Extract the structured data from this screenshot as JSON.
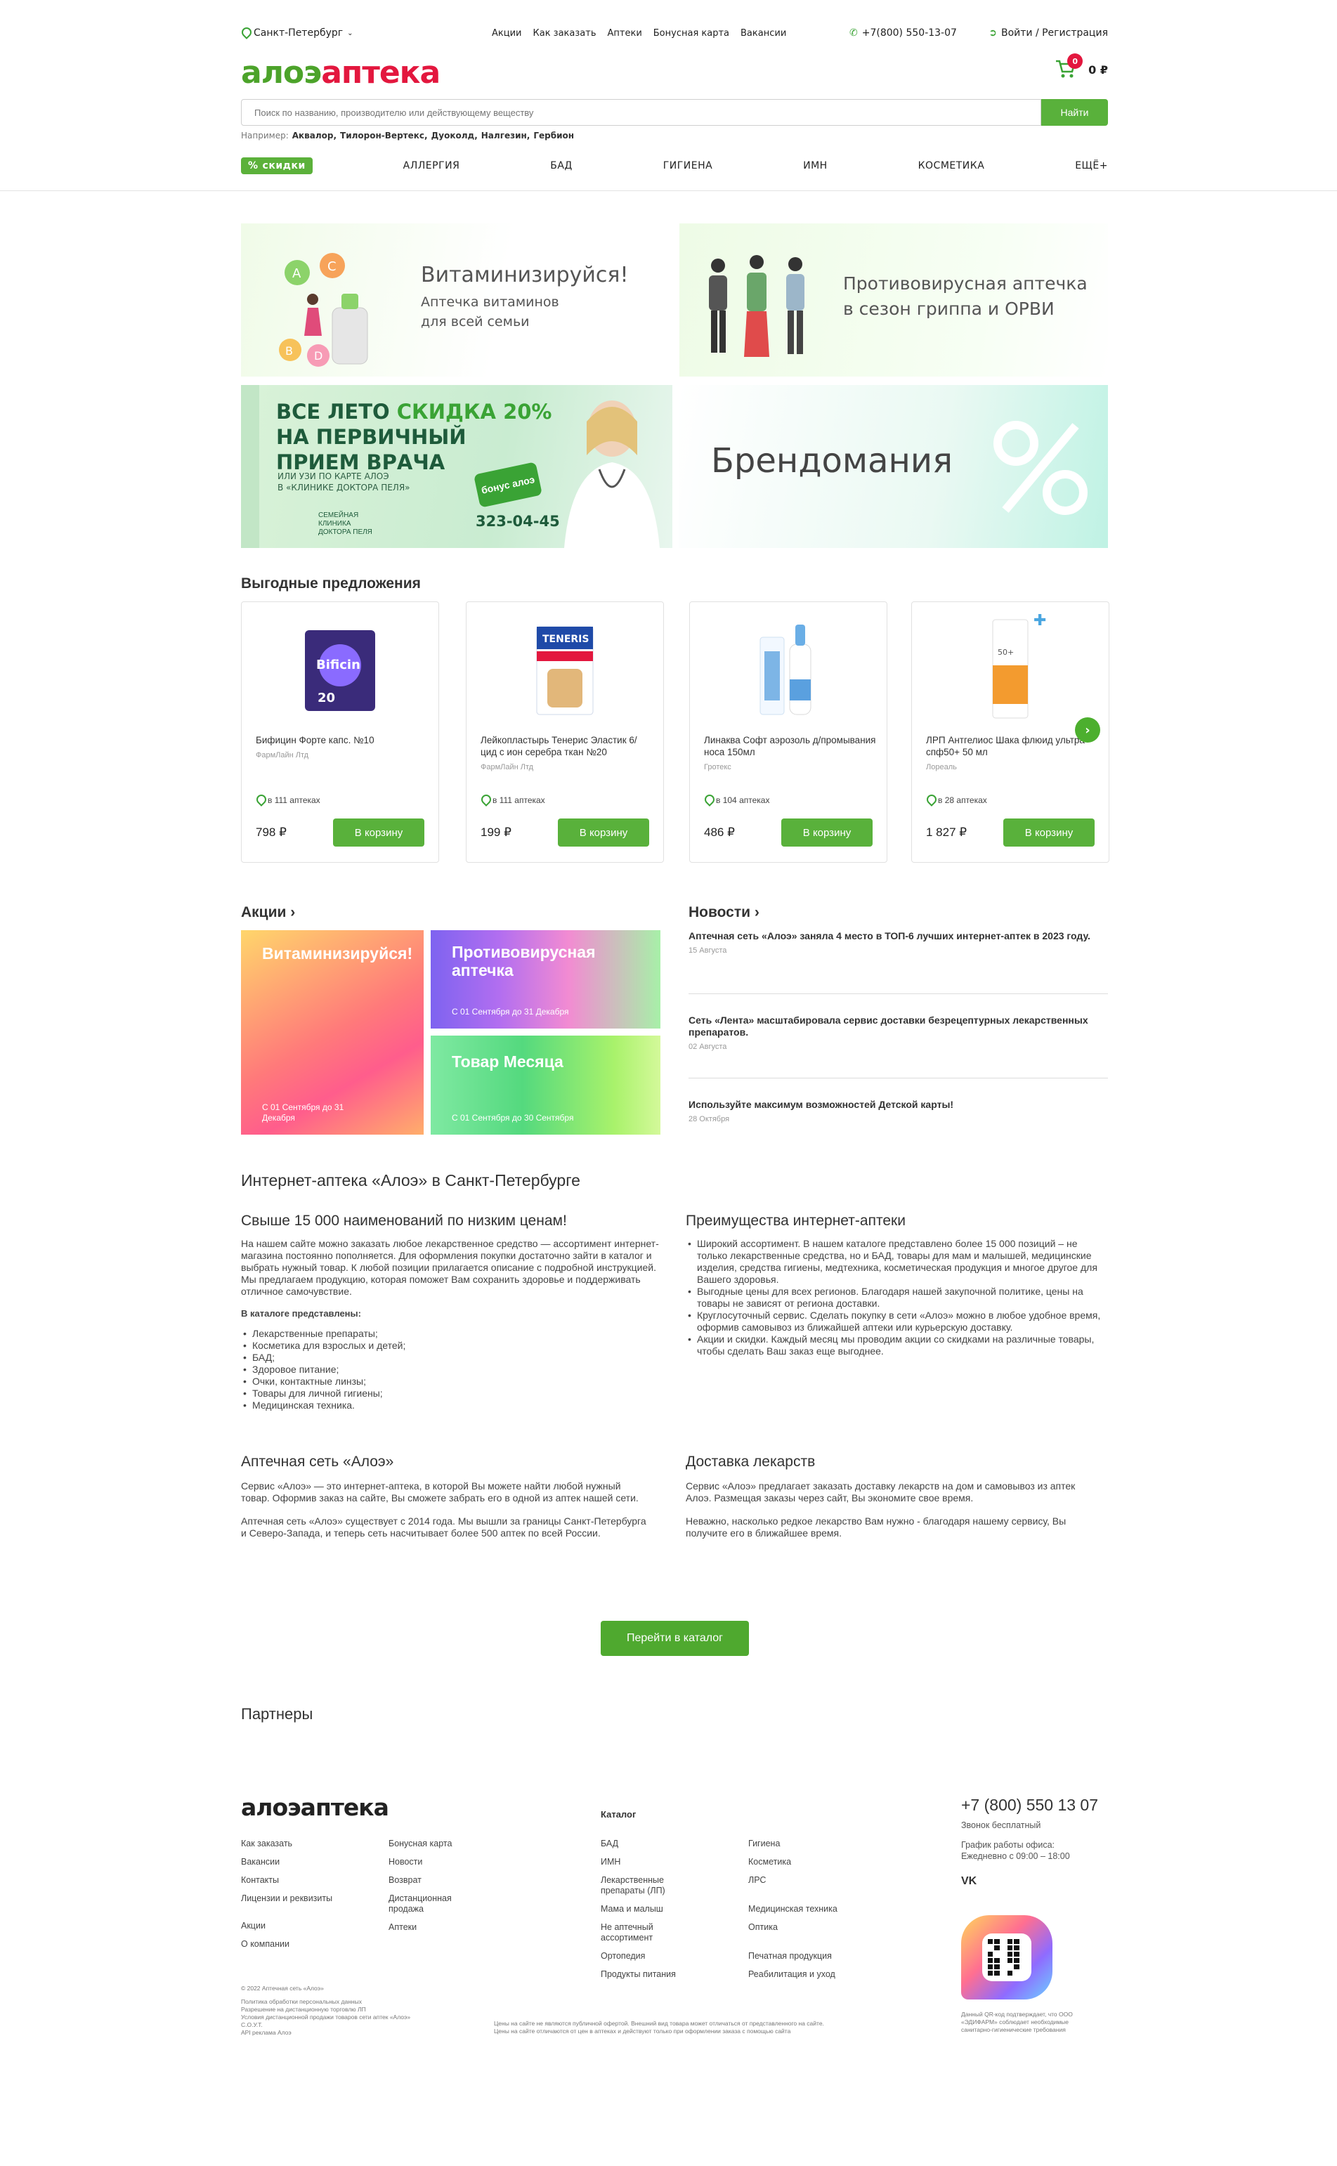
{
  "header": {
    "city": "Санкт-Петербург",
    "nav": [
      "Акции",
      "Как заказать",
      "Аптеки",
      "Бонусная карта",
      "Вакансии"
    ],
    "phone": "+7(800) 550-13-07",
    "login": "Войти / Регистрация",
    "logo_part1": "алоэ",
    "logo_part2": "аптека",
    "cart_count": "0",
    "cart_sum": "0 ₽"
  },
  "search": {
    "placeholder": "Поиск по названию, производителю или действующему веществу",
    "button": "Найти",
    "examples_label": "Например:",
    "examples": [
      "Аквалор,",
      "Тилорон-Вертекс,",
      "Дуоколд,",
      "Налгезин,",
      "Гербион"
    ]
  },
  "categories": {
    "sale": "скидки",
    "items": [
      "АЛЛЕРГИЯ",
      "БАД",
      "ГИГИЕНА",
      "ИМН",
      "КОСМЕТИКА",
      "ЕЩЁ+"
    ]
  },
  "banners": {
    "b1_title": "Витаминизируйся!",
    "b1_sub1": "Аптечка витаминов",
    "b1_sub2": "для всей семьи",
    "b2_line1": "Противовирусная аптечка",
    "b2_line2": "в сезон гриппа и ОРВИ",
    "b3_line1a": "ВСЕ ЛЕТО ",
    "b3_line1b": "СКИДКА 20%",
    "b3_line2": "НА ПЕРВИЧНЫЙ",
    "b3_line3": "ПРИЕМ ВРАЧА",
    "b3_note1": "ИЛИ УЗИ ПО КАРТЕ АЛОЭ",
    "b3_note2": "В «КЛИНИКЕ ДОКТОРА ПЕЛЯ»",
    "b3_phone": "323-04-45",
    "b3_clinic": "СЕМЕЙНАЯ КЛИНИКА ДОКТОРА ПЕЛЯ",
    "b3_bonus": "бонус алоэ",
    "b4_title": "Брендомания"
  },
  "offers": {
    "title": "Выгодные предложения",
    "items": [
      {
        "name": "Бифицин Форте капс. №10",
        "brand": "ФармЛайн Лтд",
        "avail": "в 111 аптеках",
        "price": "798 ₽",
        "button": "В корзину"
      },
      {
        "name": "Лейкопластырь Тенерис Эластик 6/цид с ион серебра ткан №20",
        "brand": "ФармЛайн Лтд",
        "avail": "в 111 аптеках",
        "price": "199 ₽",
        "button": "В корзину"
      },
      {
        "name": "Линаква Софт аэрозоль д/промывания носа 150мл",
        "brand": "Гротекс",
        "avail": "в 104 аптеках",
        "price": "486 ₽",
        "button": "В корзину"
      },
      {
        "name": "ЛРП Антгелиос Шака флюид ультра спф50+ 50 мл",
        "brand": "Лореаль",
        "avail": "в 28 аптеках",
        "price": "1 827 ₽",
        "button": "В корзину"
      }
    ]
  },
  "promos": {
    "title": "Акции",
    "items": [
      {
        "title": "Витаминизируйся!",
        "date": "С 01 Сентября до 31 Декабря"
      },
      {
        "title": "Противовирусная аптечка",
        "date": "С 01 Сентября до 31 Декабря"
      },
      {
        "title": "Товар Месяца",
        "date": "С 01 Сентября до 30 Сентября"
      }
    ]
  },
  "news": {
    "title": "Новости",
    "items": [
      {
        "title": "Аптечная сеть «Алоэ» заняла 4 место в ТОП-6 лучших интернет-аптек в 2023 году.",
        "date": "15 Августа"
      },
      {
        "title": "Сеть «Лента» масштабировала сервис доставки безрецептурных лекарственных препаратов.",
        "date": "02 Августа"
      },
      {
        "title": "Используйте максимум возможностей Детской карты!",
        "date": "28 Октября"
      }
    ]
  },
  "seo": {
    "title": "Интернет-аптека «Алоэ» в Санкт-Петербурге",
    "h_left": "Свыше 15 000 наименований по низким ценам!",
    "p_left": "На нашем сайте можно заказать любое лекарственное средство — ассортимент интернет-магазина постоянно пополняется. Для оформления покупки достаточно зайти в каталог и выбрать нужный товар. К любой позиции прилагается описание с подробной инструкцией. Мы предлагаем продукцию, которая поможет Вам сохранить здоровье и поддерживать отличное самочувствие.",
    "catalog_label": "В каталоге представлены:",
    "catalog_items": [
      "Лекарственные препараты;",
      "Косметика для взрослых и детей;",
      "БАД;",
      "Здоровое питание;",
      "Очки, контактные линзы;",
      "Товары для личной гигиены;",
      "Медицинская техника."
    ],
    "h_right": "Преимущества интернет-аптеки",
    "adv_items": [
      "Широкий ассортимент. В нашем каталоге представлено более 15 000 позиций – не только лекарственные средства, но и БАД, товары для мам и малышей, медицинские изделия, средства гигиены, медтехника, косметическая продукция и многое другое для Вашего здоровья.",
      "Выгодные цены для всех регионов. Благодаря нашей закупочной политике, цены на товары не зависят от региона доставки.",
      "Круглосуточный сервис. Сделать покупку в сети «Алоэ» можно в любое удобное время, оформив самовывоз из ближайшей аптеки или курьерскую доставку.",
      "Акции и скидки. Каждый месяц мы  проводим акции со скидками на различные товары, чтобы сделать Ваш заказ еще выгоднее."
    ],
    "h_net": "Аптечная сеть «Алоэ»",
    "p_net1": "Сервис «Алоэ» — это интернет-аптека, в которой Вы можете найти любой нужный товар. Оформив заказ на сайте, Вы сможете забрать его в одной из аптек нашей сети.",
    "p_net2": "Аптечная сеть «Алоэ» существует с 2014 года. Мы вышли за границы Санкт-Петербурга и Северо-Запада, и теперь сеть насчитывает более 500 аптек по всей России.",
    "h_deliv": "Доставка лекарств",
    "p_deliv1": "Сервис «Алоэ» предлагает заказать доставку лекарств на дом и самовывоз из аптек Алоэ. Размещая заказы через сайт, Вы экономите свое время.",
    "p_deliv2": "Неважно, насколько редкое лекарство Вам нужно - благодаря нашему сервису, Вы получите его в ближайшее время.",
    "catalog_button": "Перейти в каталог"
  },
  "partners": {
    "title": "Партнеры"
  },
  "footer": {
    "logo": "алоэаптека",
    "col1": [
      "Как заказать",
      "Вакансии",
      "Контакты",
      "Лицензии и реквизиты",
      "Акции",
      "О компании"
    ],
    "col2": [
      "Бонусная карта",
      "Новости",
      "Возврат",
      "Дистанционная продажа",
      "Аптеки"
    ],
    "catalog_title": "Каталог",
    "cat1": [
      "БАД",
      "ИМН",
      "Лекарственные препараты (ЛП)",
      "Мама и малыш",
      "Не аптечный ассортимент",
      "Ортопедия",
      "Продукты питания"
    ],
    "cat2": [
      "Гигиена",
      "Косметика",
      "ЛРС",
      "Медицинская техника",
      "Оптика",
      "Печатная продукция",
      "Реабилитация и уход"
    ],
    "phone": "+7 (800) 550 13 07",
    "phone_note": "Звонок бесплатный",
    "hours_label": "График работы офиса:",
    "hours": "Ежедневно с 09:00 – 18:00",
    "vk": "VK",
    "copyright": "© 2022 Аптечная сеть «Алоэ»",
    "legal": [
      "Политика обработки персональных данных",
      "Разрешение на дистанционную торговлю ЛП",
      "Условия дистанционной продажи товаров сети аптек «Алоэ»",
      "С.О.У.Т.",
      "API реклама Алоэ"
    ],
    "disclaimer": "Цены на сайте не являются публичной офертой. Внешний вид товара может отличаться от представленного на сайте. Цены на сайте отличаются от цен в аптеках и действуют только при оформлении заказа с помощью сайта",
    "qr_note": "Данный QR-код подтверждает, что ООО «ЭДИФАРМ» соблюдает необходимые санитарно-гигиенические требования"
  }
}
